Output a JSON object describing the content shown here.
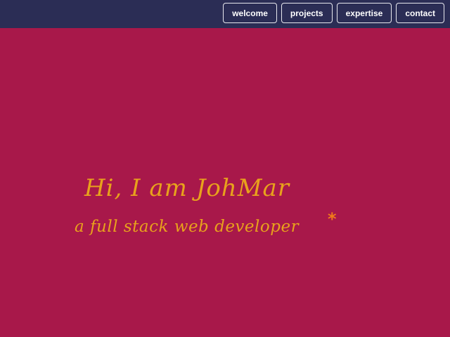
{
  "nav": {
    "items": [
      {
        "label": "welcome"
      },
      {
        "label": "projects"
      },
      {
        "label": "expertise"
      },
      {
        "label": "contact"
      }
    ]
  },
  "hero": {
    "title": "Hi, I am JohMar",
    "subtitle": "a full stack web developer",
    "cursor": "*"
  },
  "colors": {
    "navbar_bg": "#2b2d55",
    "page_bg": "#a8184a",
    "hero_text": "#e8a21c",
    "cursor": "#f07a1a"
  }
}
